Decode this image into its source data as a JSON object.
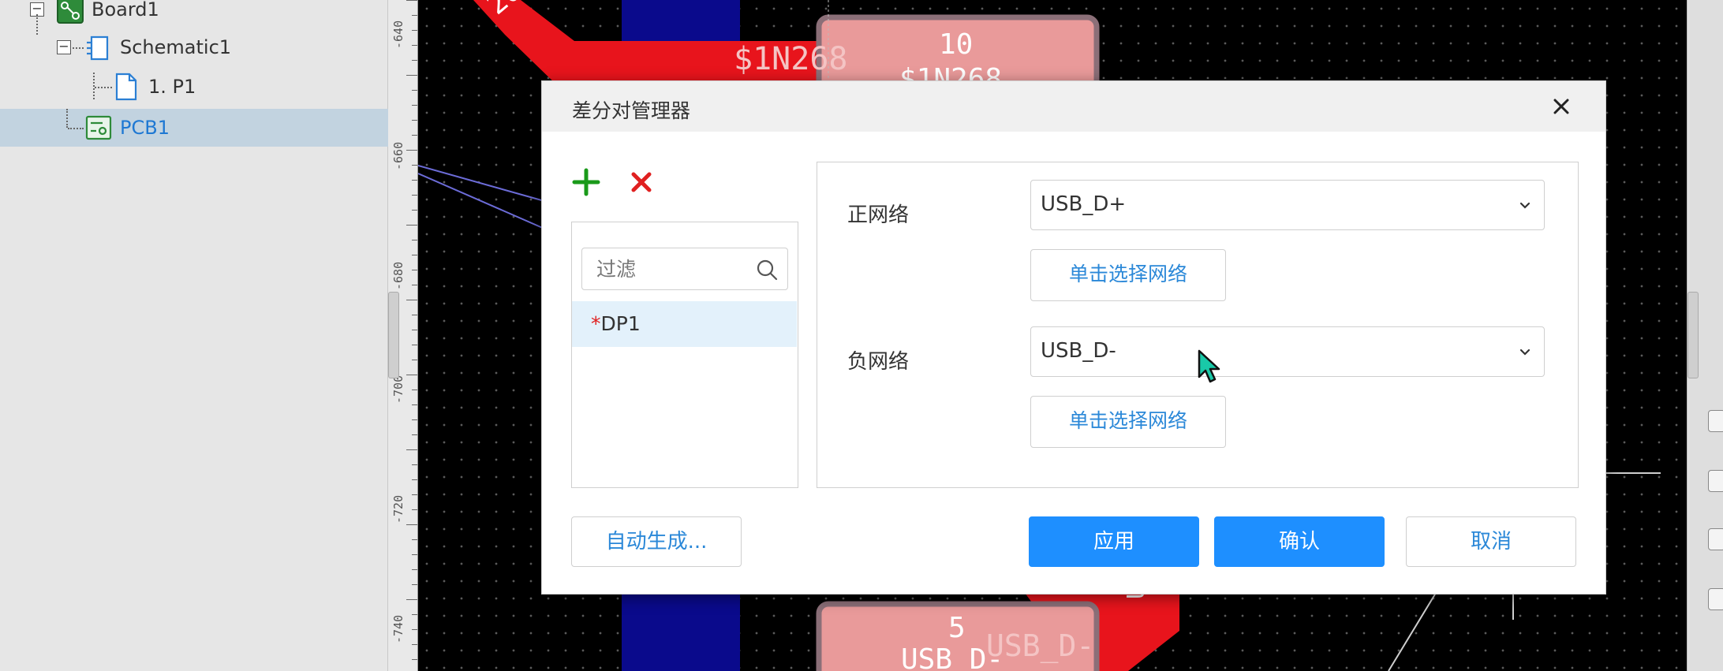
{
  "tree": {
    "items": [
      {
        "label": "Board1",
        "icon": "board-icon"
      },
      {
        "label": "Schematic1",
        "icon": "schematic-icon"
      },
      {
        "label": "1. P1",
        "icon": "page-icon"
      },
      {
        "label": "PCB1",
        "icon": "pcb-icon",
        "selected": true
      }
    ]
  },
  "ruler": {
    "labels": [
      "-640",
      "-660",
      "-680",
      "-700",
      "-720",
      "-740"
    ]
  },
  "canvas": {
    "labels": {
      "net_top": "$1N268",
      "net_top_partial": "268",
      "pad_top_number": "10",
      "pad_top_net": "$1N268",
      "pad_bottom_number": "5",
      "pad_bottom_net": "USB_D-",
      "pad_bottom_net2": "USB_D-",
      "trace_partial": "U"
    },
    "colors": {
      "background": "#000000",
      "top_copper": "#e8141c",
      "bottom_copper": "#0a0a8c",
      "pad": "#e99a9a"
    }
  },
  "dialog": {
    "title": "差分对管理器",
    "filter_placeholder": "过滤",
    "pairs": [
      {
        "required_mark": "*",
        "name": "DP1"
      }
    ],
    "positive_label": "正网络",
    "positive_value": "USB_D+",
    "negative_label": "负网络",
    "negative_value": "USB_D-",
    "pick_net_label": "单击选择网络",
    "auto_generate_label": "自动生成...",
    "apply_label": "应用",
    "ok_label": "确认",
    "cancel_label": "取消",
    "colors": {
      "primary": "#1e8fff",
      "link": "#2b88d8",
      "add": "#1a9a1a",
      "delete": "#e02020"
    }
  }
}
